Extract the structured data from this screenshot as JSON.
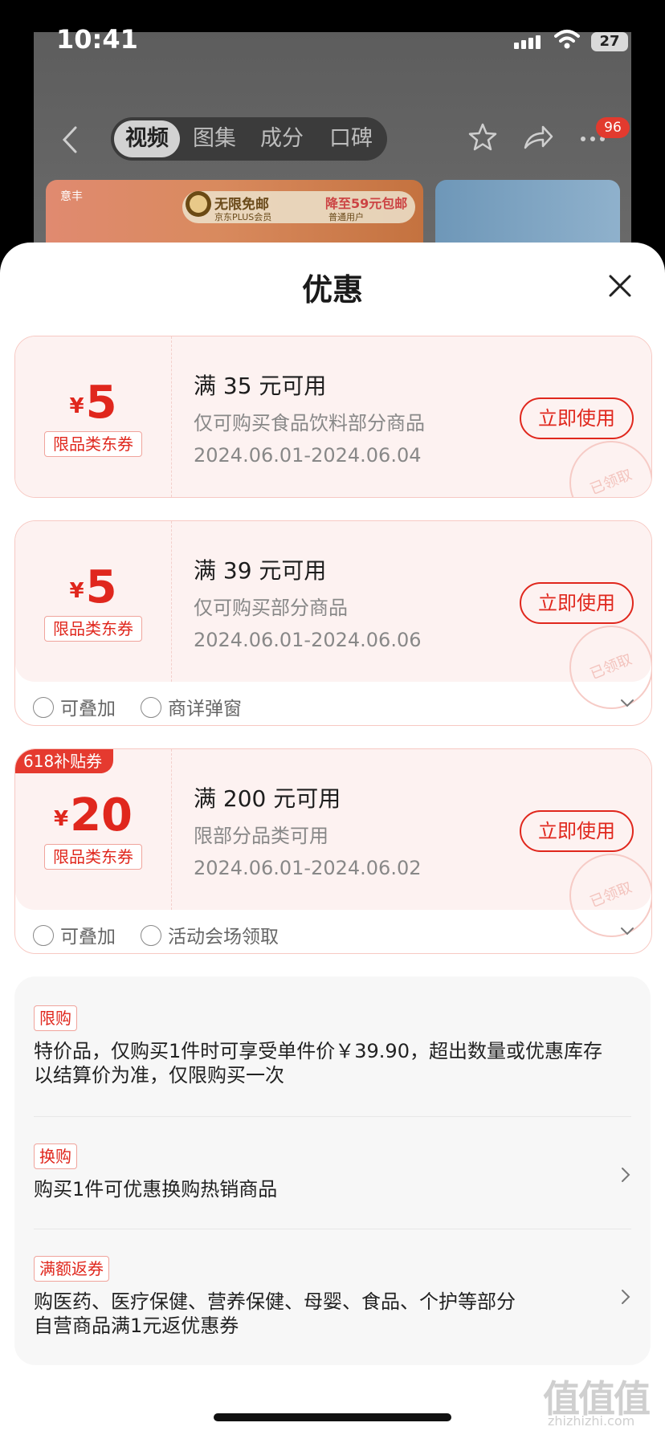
{
  "status": {
    "time": "10:41",
    "battery": "27"
  },
  "nav": {
    "tabs": [
      {
        "label": "视频",
        "active": true
      },
      {
        "label": "图集",
        "active": false
      },
      {
        "label": "成分",
        "active": false
      },
      {
        "label": "口碑",
        "active": false
      }
    ],
    "message_badge": "96"
  },
  "banner": {
    "brand": "意丰",
    "promo_title": "无限免邮",
    "promo_sub": "京东PLUS会员",
    "promo_right": "降至59元包邮",
    "promo_right_sub": "普通用户"
  },
  "sheet": {
    "title": "优惠"
  },
  "coupons": [
    {
      "currency": "¥",
      "amount": "5",
      "tag": "限品类东券",
      "condition": "满 35 元可用",
      "scope": "仅可购买食品饮料部分商品",
      "date": "2024.06.01-2024.06.04",
      "button": "立即使用",
      "stamp": "已领取"
    },
    {
      "currency": "¥",
      "amount": "5",
      "tag": "限品类东券",
      "condition": "满 39 元可用",
      "scope": "仅可购买部分商品",
      "date": "2024.06.01-2024.06.06",
      "button": "立即使用",
      "stamp": "已领取",
      "footer": {
        "stack": "可叠加",
        "source": "商详弹窗"
      }
    },
    {
      "badge": "618补贴券",
      "currency": "¥",
      "amount": "20",
      "tag": "限品类东券",
      "condition": "满 200 元可用",
      "scope": "限部分品类可用",
      "date": "2024.06.01-2024.06.02",
      "button": "立即使用",
      "stamp": "已领取",
      "footer": {
        "stack": "可叠加",
        "source": "活动会场领取"
      }
    }
  ],
  "promos": [
    {
      "tag": "限购",
      "text": "特价品，仅购买1件时可享受单件价￥39.90，超出数量或优惠库存以结算价为准，仅限购买一次"
    },
    {
      "tag": "换购",
      "text": "购买1件可优惠换购热销商品"
    },
    {
      "tag": "满额返券",
      "text": "购医药、医疗保健、营养保健、母婴、食品、个护等部分自营商品满1元返优惠券"
    }
  ],
  "watermark": {
    "logo": "值值值",
    "url": "zhizhizhi.com"
  }
}
